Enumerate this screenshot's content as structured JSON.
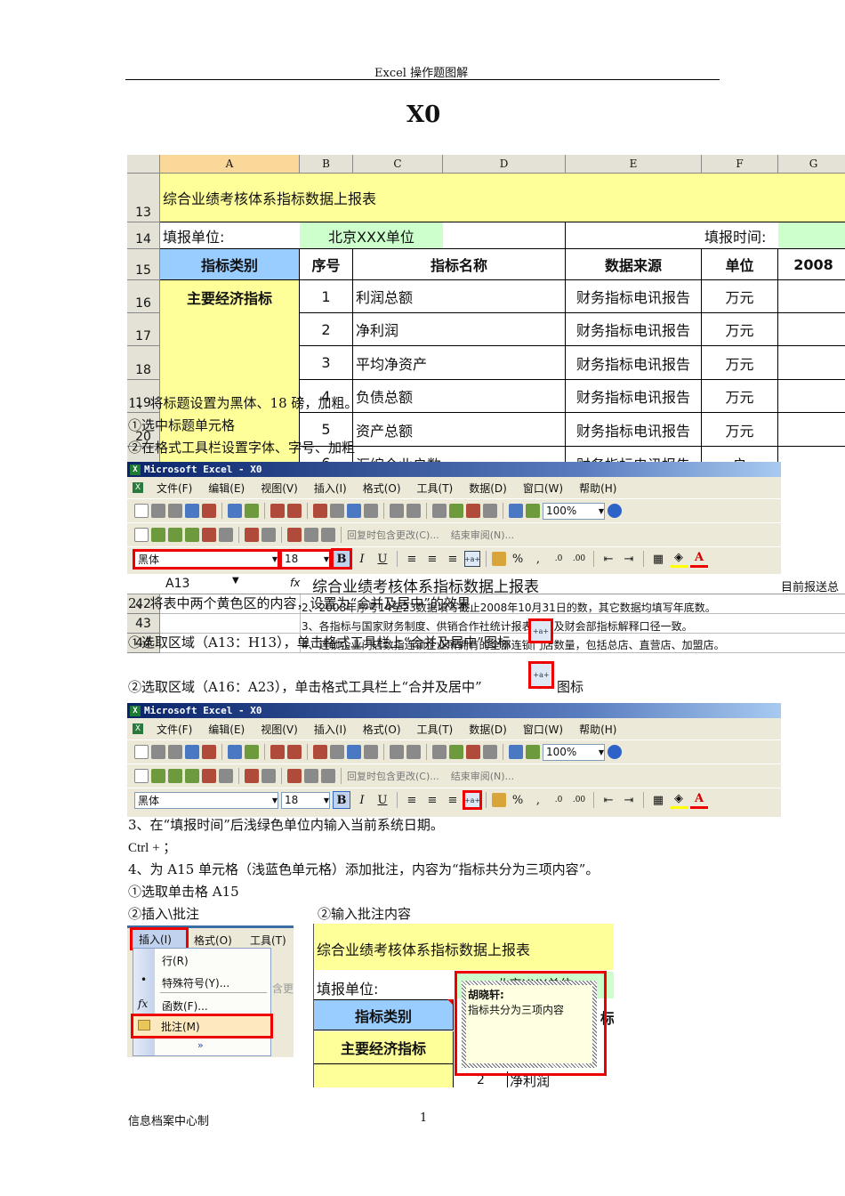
{
  "header": {
    "running_title": "Excel 操作题图解",
    "doc_title": "X0"
  },
  "sheet": {
    "columns": [
      "A",
      "B",
      "C",
      "D",
      "E",
      "F",
      "G"
    ],
    "rows": [
      {
        "n": "13",
        "cells": [
          "综合业绩考核体系指标数据上报表"
        ]
      },
      {
        "n": "14",
        "cells": [
          "填报单位:",
          "北京XXX单位",
          "",
          "",
          "填报时间:",
          ""
        ]
      },
      {
        "n": "15",
        "cells": [
          "指标类别",
          "序号",
          "指标名称",
          "数据来源",
          "单位",
          "2008"
        ]
      },
      {
        "n": "16",
        "cells": [
          "主要经济指标",
          "1",
          "利润总额",
          "财务指标电讯报告",
          "万元"
        ]
      },
      {
        "n": "17",
        "cells": [
          "",
          "2",
          "净利润",
          "财务指标电讯报告",
          "万元"
        ]
      },
      {
        "n": "18",
        "cells": [
          "",
          "3",
          "平均净资产",
          "财务指标电讯报告",
          "万元"
        ]
      },
      {
        "n": "19",
        "cells": [
          "",
          "4",
          "负债总额",
          "财务指标电讯报告",
          "万元"
        ]
      },
      {
        "n": "20",
        "cells": [
          "",
          "5",
          "资产总额",
          "财务指标电讯报告",
          "万元"
        ]
      },
      {
        "n": "21",
        "cells": [
          "",
          "6",
          "汇编企业户数",
          "财务指标电讯报告",
          "户"
        ]
      }
    ]
  },
  "steps": {
    "s1": "1、将标题设置为黑体、18 磅，加粗。",
    "s1a": "①选中标题单元格",
    "s1b": "②在格式工具栏设置字体、字号、加粗",
    "s2": "2、将表中两个黄色区的内容，设置为“合并及居中”的效果",
    "s2a": "①选取区域（A13：H13），单击格式工具栏上“合并及居中”图标",
    "s2b_pre": "②选取区域（A16：A23），单击格式工具栏上“合并及居中”",
    "s2b_post": "图标",
    "s3": "3、在“填报时间”后浅绿色单位内输入当前系统日期。",
    "s3a": "Ctrl + ；",
    "s4": "4、为 A15 单元格（浅蓝色单元格）添加批注，内容为“指标共分为三项内容”。",
    "s4a": "①选取单击格 A15",
    "s4b": "②插入\\批注",
    "s4c": "②输入批注内容"
  },
  "excel": {
    "title": "Microsoft Excel - X0",
    "menus": [
      "文件(F)",
      "编辑(E)",
      "视图(V)",
      "插入(I)",
      "格式(O)",
      "工具(T)",
      "数据(D)",
      "窗口(W)",
      "帮助(H)"
    ],
    "zoom": "100%",
    "review_reply": "回复时包含更改(C)...",
    "review_end": "结束审阅(N)...",
    "font": "黑体",
    "size": "18",
    "bold": "B",
    "italic": "I",
    "underline": "U",
    "percent": "%",
    "comma": ",",
    "name_box": "A13",
    "fx": "fx",
    "formula": "综合业绩考核体系指标数据上报表",
    "formula_right": "目前报送总和",
    "row42": "42",
    "row43": "43",
    "row44": "44",
    "note2": "2、2008年序号14至23数据填写截止2008年10月31日的数，其它数据均填写年底数。",
    "note3": "3、各指标与国家财务制度、供销合作社统计报表制度及财会部指标解释口径一致。",
    "note4": "4、连锁企业门店数指连锁企业所拥有的全部连锁门店数量，包括总店、直营店、加盟店。",
    "col_g_dash": "–"
  },
  "insert_menu": {
    "bar": [
      "插入(I)",
      "格式(O)",
      "工具(T)"
    ],
    "items": [
      "行(R)",
      "特殊符号(Y)...",
      "函数(F)...",
      "批注(M)"
    ],
    "bg_text": "含更"
  },
  "comment_shot": {
    "title": "综合业绩考核体系指标数据上报表",
    "unit_label": "填报单位:",
    "unit_value": "北京XXX单位",
    "category": "指标类别",
    "main": "主要经济指标",
    "peek": "标",
    "num": "2",
    "name": "净利润",
    "author": "胡晓轩:",
    "comment": "指标共分为三项内容"
  },
  "footer": {
    "left": "信息档案中心制",
    "page": "1"
  }
}
